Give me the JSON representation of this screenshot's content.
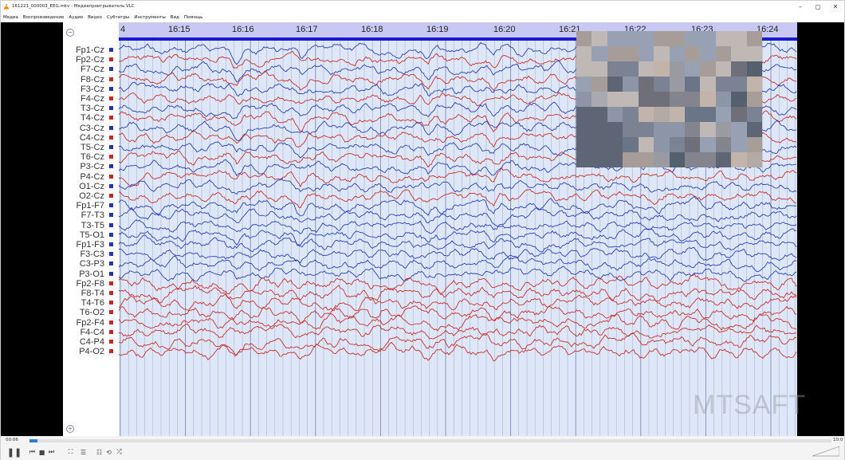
{
  "window": {
    "title": "161221_000003_EEG.mkv - Медиапроигрыватель VLC",
    "controls": [
      "–",
      "◻",
      "✕"
    ]
  },
  "menu": [
    "Медиа",
    "Воспроизведение",
    "Аудио",
    "Видео",
    "Субтитры",
    "Инструменты",
    "Вид",
    "Помощь"
  ],
  "eeg": {
    "time_ticks": [
      "4",
      "16:15",
      "16:16",
      "16:17",
      "16:18",
      "16:19",
      "16:20",
      "16:21",
      "16:22",
      "16:23",
      "16:24"
    ],
    "channels": [
      {
        "name": "Fp1-Cz",
        "color": "#2233bb"
      },
      {
        "name": "Fp2-Cz",
        "color": "#cc2222"
      },
      {
        "name": "F7-Cz",
        "color": "#2233bb"
      },
      {
        "name": "F8-Cz",
        "color": "#cc2222"
      },
      {
        "name": "F3-Cz",
        "color": "#2233bb"
      },
      {
        "name": "F4-Cz",
        "color": "#cc2222"
      },
      {
        "name": "T3-Cz",
        "color": "#2233bb"
      },
      {
        "name": "T4-Cz",
        "color": "#cc2222"
      },
      {
        "name": "C3-Cz",
        "color": "#2233bb"
      },
      {
        "name": "C4-Cz",
        "color": "#cc2222"
      },
      {
        "name": "T5-Cz",
        "color": "#2233bb"
      },
      {
        "name": "T6-Cz",
        "color": "#cc2222"
      },
      {
        "name": "P3-Cz",
        "color": "#2233bb"
      },
      {
        "name": "P4-Cz",
        "color": "#cc2222"
      },
      {
        "name": "O1-Cz",
        "color": "#2233bb"
      },
      {
        "name": "O2-Cz",
        "color": "#cc2222"
      },
      {
        "name": "Fp1-F7",
        "color": "#2233bb"
      },
      {
        "name": "F7-T3",
        "color": "#2233bb"
      },
      {
        "name": "T3-T5",
        "color": "#2233bb"
      },
      {
        "name": "T5-O1",
        "color": "#2233bb"
      },
      {
        "name": "Fp1-F3",
        "color": "#2233bb"
      },
      {
        "name": "F3-C3",
        "color": "#2233bb"
      },
      {
        "name": "C3-P3",
        "color": "#2233bb"
      },
      {
        "name": "P3-O1",
        "color": "#2233bb"
      },
      {
        "name": "Fp2-F8",
        "color": "#cc2222"
      },
      {
        "name": "F8-T4",
        "color": "#cc2222"
      },
      {
        "name": "T4-T6",
        "color": "#cc2222"
      },
      {
        "name": "T6-O2",
        "color": "#cc2222"
      },
      {
        "name": "Fp2-F4",
        "color": "#cc2222"
      },
      {
        "name": "F4-C4",
        "color": "#cc2222"
      },
      {
        "name": "C4-P4",
        "color": "#cc2222"
      },
      {
        "name": "P4-O2",
        "color": "#cc2222"
      }
    ],
    "zoom_top_icon": "zoom-out-icon",
    "zoom_bottom_icon": "zoom-in-icon",
    "colors": {
      "blue": "#2233bb",
      "red": "#cc2222",
      "grid": "#9aa6c8",
      "background": "#dde7f7",
      "header": "#c8c8f2",
      "marker": "#1a1ad0"
    }
  },
  "watermark": "MTSAFT",
  "player": {
    "time_elapsed": "00:06",
    "time_total": "10:0",
    "progress": 0.01,
    "buttons": [
      {
        "name": "pause-button",
        "glyph": "❚❚"
      },
      {
        "name": "previous-button",
        "glyph": "⏮"
      },
      {
        "name": "stop-button",
        "glyph": "■"
      },
      {
        "name": "next-button",
        "glyph": "⏭"
      },
      {
        "name": "fullscreen-button",
        "glyph": "⛶"
      },
      {
        "name": "extended-settings-button",
        "glyph": "☰"
      },
      {
        "name": "playlist-button",
        "glyph": "☷"
      },
      {
        "name": "loop-button",
        "glyph": "⟲"
      },
      {
        "name": "shuffle-button",
        "glyph": "⤮"
      }
    ],
    "accent": "#2d7bd8"
  }
}
